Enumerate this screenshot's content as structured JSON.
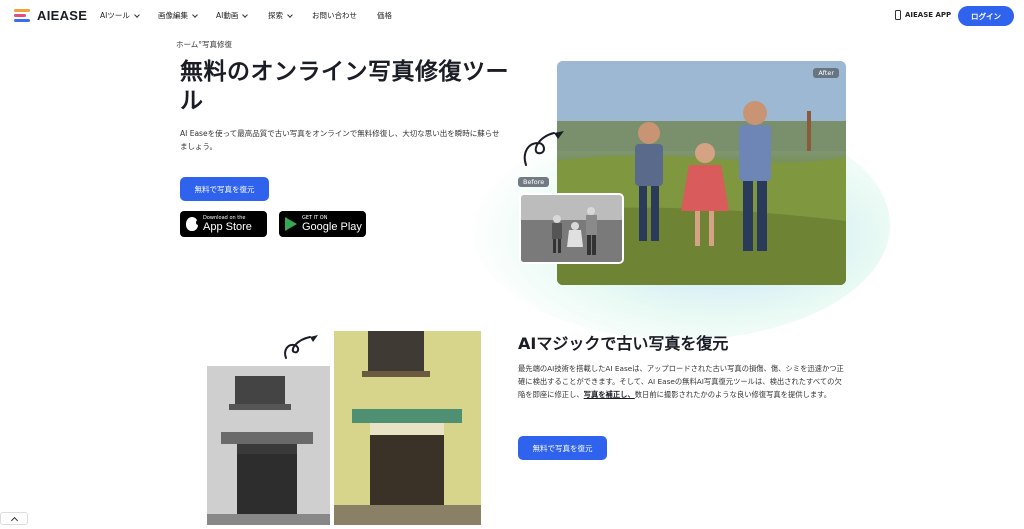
{
  "brand": {
    "name": "AIEASE",
    "colors": {
      "accent": "#2f63ee",
      "logo_orange": "#f0a23a",
      "logo_pink": "#e64b7a",
      "logo_blue": "#3b6cf0"
    }
  },
  "nav": {
    "items": [
      {
        "label": "AIツール",
        "has_menu": true
      },
      {
        "label": "画像編集",
        "has_menu": true
      },
      {
        "label": "AI動画",
        "has_menu": true
      },
      {
        "label": "探索",
        "has_menu": true
      },
      {
        "label": "お問い合わせ",
        "has_menu": false
      },
      {
        "label": "価格",
        "has_menu": false
      }
    ],
    "app_label": "AIEASE APP",
    "login_label": "ログイン"
  },
  "hero": {
    "breadcrumb": "ホーム°写真修復",
    "title": "無料のオンライン写真修復ツール",
    "description": "AI Easeを使って最高品質で古い写真をオンラインで無料修復し、大切な思い出を瞬時に蘇らせましょう。",
    "cta_label": "無料で写真を復元",
    "app_store": {
      "small": "Download on the",
      "big": "App Store"
    },
    "google_play": {
      "small": "GET IT ON",
      "big": "Google Play"
    },
    "after_badge": "After",
    "before_badge": "Before"
  },
  "section2": {
    "title": "AIマジックで古い写真を復元",
    "text_before": "最先端のAI技術を搭載したAI Easeは、アップロードされた古い写真の損傷、傷、シミを迅速かつ正確に検出することができます。そして、AI Easeの無料AI写真復元ツールは、検出されたすべての欠陥を即座に修正し、",
    "text_link": "写真を補正し、",
    "text_after": "数日前に撮影されたかのような良い修復写真を提供します。",
    "cta_label": "無料で写真を復元"
  }
}
